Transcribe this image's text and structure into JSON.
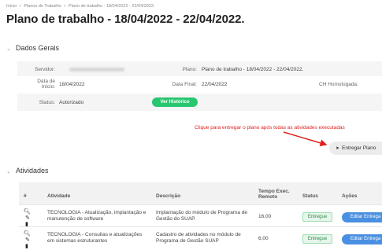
{
  "breadcrumb": {
    "items": [
      "Início",
      "Planos de Trabalho",
      "Plano de trabalho - 18/04/2022 - 22/04/2022."
    ],
    "separator": ">"
  },
  "page_title": "Plano de trabalho - 18/04/2022 - 22/04/2022.",
  "dados_gerais": {
    "section_title": "Dados Gerais",
    "servidor_label": "Servidor:",
    "servidor_value": "",
    "plano_label": "Plano:",
    "plano_value": "Plano de trabalho - 18/04/2022 - 22/04/2022.",
    "data_inicio_label": "Data de Início:",
    "data_inicio_value": "18/04/2022",
    "data_final_label": "Data Final:",
    "data_final_value": "22/04/2022",
    "ch_homologada_label": "CH Homologada:",
    "status_label": "Status:",
    "status_value": "Autorizado",
    "ver_historico_label": "Ver Histórico"
  },
  "annotation": {
    "text": "Clique para entregar o plano após todas as atividades executadas",
    "color": "#e02020"
  },
  "entregar_button": {
    "label": "Entregar Plano",
    "icon": "send-icon"
  },
  "atividades": {
    "section_title": "Atividades",
    "columns": [
      "#",
      "Atividade",
      "Descrição",
      "Tempo Exec. Remoto",
      "Status",
      "Ações"
    ],
    "rows": [
      {
        "atividade": "TECNOLOGIA - Atualização, implantação e manutenção de software",
        "descricao": "Implantação do módulo de Programa de Gestão do SUAP.",
        "tempo": "16,00",
        "status": "Entregue",
        "acao": "Editar Entrega"
      },
      {
        "atividade": "TECNOLOGIA - Consultas e atualizações em sistemas estruturantes",
        "descricao": "Cadastro de atividades no módulo de Programa de Gestão SUAP",
        "tempo": "6,00",
        "status": "Entregue",
        "acao": "Editar Entrega"
      }
    ]
  },
  "colors": {
    "accent_green": "#28c76f",
    "accent_blue": "#4a90e2",
    "status_green_text": "#2e8b4c"
  }
}
